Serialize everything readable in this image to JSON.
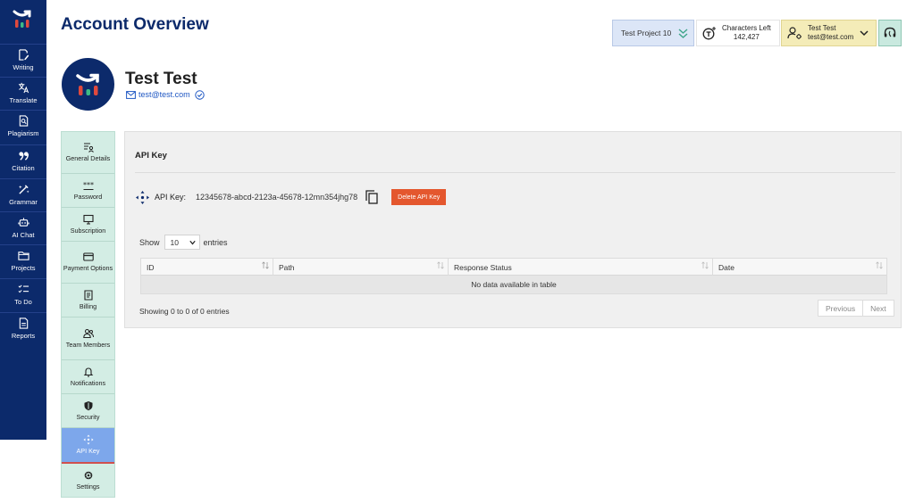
{
  "header": {
    "title": "Account Overview",
    "project": "Test Project 10",
    "characters_label": "Characters Left",
    "characters_value": "142,427",
    "user_name": "Test Test",
    "user_email": "test@test.com"
  },
  "sidebar": {
    "items": [
      {
        "label": "Writing",
        "icon": "writing-icon"
      },
      {
        "label": "Translate",
        "icon": "translate-icon"
      },
      {
        "label": "Plagiarism",
        "icon": "plagiarism-icon"
      },
      {
        "label": "Citation",
        "icon": "citation-icon"
      },
      {
        "label": "Grammar",
        "icon": "grammar-icon"
      },
      {
        "label": "AI Chat",
        "icon": "ai-chat-icon"
      },
      {
        "label": "Projects",
        "icon": "projects-icon"
      },
      {
        "label": "To Do",
        "icon": "todo-icon"
      },
      {
        "label": "Reports",
        "icon": "reports-icon"
      }
    ]
  },
  "profile": {
    "name": "Test Test",
    "email": "test@test.com"
  },
  "tabs": [
    {
      "label": "General Details",
      "icon": "general-details-icon"
    },
    {
      "label": "Password",
      "icon": "password-icon"
    },
    {
      "label": "Subscription",
      "icon": "subscription-icon"
    },
    {
      "label": "Payment Options",
      "icon": "payment-card-icon"
    },
    {
      "label": "Billing",
      "icon": "billing-icon"
    },
    {
      "label": "Team Members",
      "icon": "team-members-icon"
    },
    {
      "label": "Notifications",
      "icon": "bell-icon"
    },
    {
      "label": "Security",
      "icon": "shield-icon"
    },
    {
      "label": "API Key",
      "icon": "api-key-icon",
      "active": true
    },
    {
      "label": "Settings",
      "icon": "gear-icon"
    }
  ],
  "api": {
    "section_title": "API Key",
    "key_label": "API Key:",
    "key_value": "12345678-abcd-2123a-45678-12mn354jhg78",
    "delete_label": "Delete API Key"
  },
  "table": {
    "show_label": "Show",
    "entries_value": "10",
    "entries_label": "entries",
    "columns": [
      "ID",
      "Path",
      "Response Status",
      "Date"
    ],
    "empty_text": "No data available in table",
    "info": "Showing 0 to 0 of 0 entries",
    "prev_label": "Previous",
    "next_label": "Next"
  },
  "colors": {
    "navy": "#0c2a6b",
    "tabs_bg": "#d3ede4",
    "active_tab": "#7da7eb",
    "delete_button": "#e4572e"
  }
}
